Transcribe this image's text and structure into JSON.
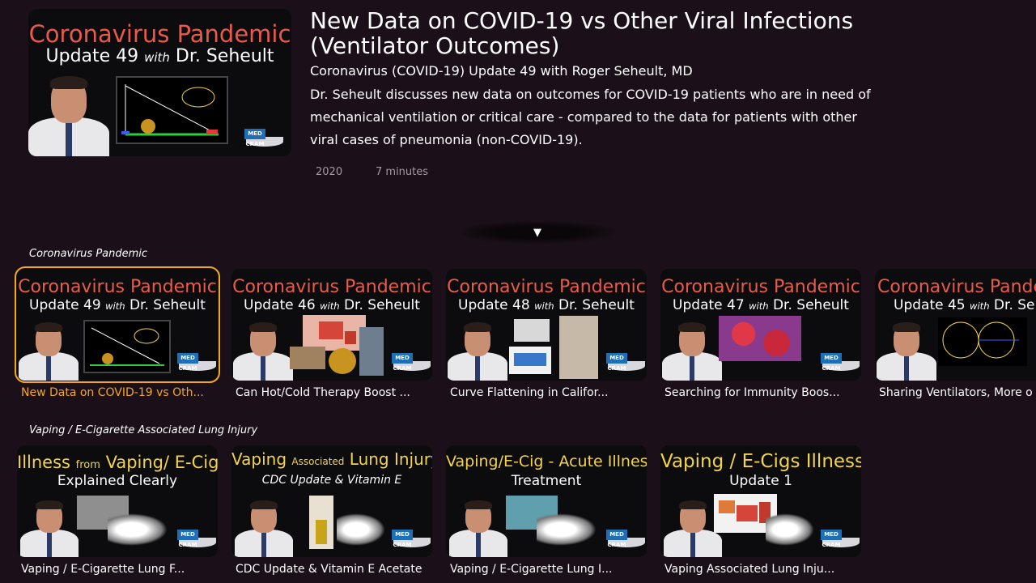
{
  "hero": {
    "thumbnail": {
      "line1": "Coronavirus Pandemic",
      "line2a": "Update 49 ",
      "line2b": "with",
      "line2c": " Dr. Seheult"
    },
    "title": "New Data on COVID-19 vs Other Viral Infections (Ventilator Outcomes)",
    "subtitle": "Coronavirus (COVID-19) Update 49 with Roger Seheult, MD",
    "description": "Dr. Seheult discusses new data on outcomes for COVID-19 patients who are in need of mechanical ventilation or critical care - compared to the data for patients with other viral cases of pneumonia (non-COVID-19).",
    "year": "2020",
    "duration": "7 minutes",
    "expand_icon": "▼"
  },
  "rows": [
    {
      "heading": "Coronavirus Pandemic",
      "cards": [
        {
          "line1": "Coronavirus Pandemic",
          "line2a": "Update 49 ",
          "line2b": "with",
          "line2c": " Dr. Seheult",
          "label": "New Data on COVID-19 vs Oth...",
          "selected": true
        },
        {
          "line1": "Coronavirus Pandemic",
          "line2a": "Update 46 ",
          "line2b": "with",
          "line2c": " Dr. Seheult",
          "label": "Can Hot/Cold Therapy Boost ..."
        },
        {
          "line1": "Coronavirus Pandemic",
          "line2a": "Update 48 ",
          "line2b": "with",
          "line2c": " Dr. Seheult",
          "label": "Curve Flattening in Califor..."
        },
        {
          "line1": "Coronavirus Pandemic",
          "line2a": "Update 47 ",
          "line2b": "with",
          "line2c": " Dr. Seheult",
          "label": "Searching for Immunity Boos..."
        },
        {
          "line1": "Coronavirus Pande",
          "line2a": "Update 45 ",
          "line2b": "with",
          "line2c": " Dr. Sehe",
          "label": "Sharing Ventilators, More o"
        }
      ]
    },
    {
      "heading": "Vaping / E-Cigarette Associated Lung Injury",
      "cards": [
        {
          "line1a": "Illness ",
          "line1b": "from",
          "line1c": " Vaping/ E-Cigs",
          "line2": "Explained Clearly",
          "label": "Vaping / E-Cigarette Lung F..."
        },
        {
          "line1a": "Vaping ",
          "line1b": "Associated",
          "line1c": " Lung Injury",
          "line2": "CDC Update & Vitamin E",
          "label": "CDC Update & Vitamin E Acetate"
        },
        {
          "line1a": "Vaping/E-Cig - Acute Illness",
          "line1b": "",
          "line1c": "",
          "line2": "Treatment",
          "label": "Vaping / E-Cigarette Lung I..."
        },
        {
          "line1a": "Vaping / E-Cigs Illness",
          "line1b": "",
          "line1c": "",
          "line2": "Update 1",
          "label": "Vaping Associated Lung Inju..."
        }
      ]
    }
  ],
  "brand": {
    "badge": "MED CRAM"
  },
  "colors": {
    "background": "#1b1019",
    "accent": "#f0a91c",
    "title_red": "#ea5a4a",
    "title_yellow": "#f3d34a"
  }
}
